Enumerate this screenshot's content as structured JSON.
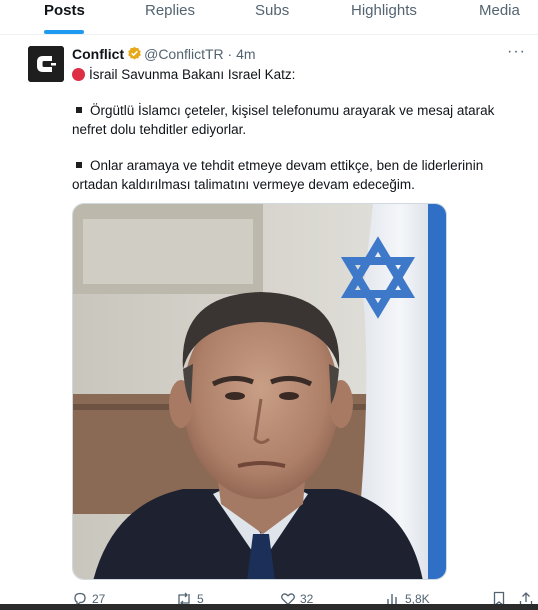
{
  "tabs": [
    {
      "label": "Posts",
      "active": true
    },
    {
      "label": "Replies",
      "active": false
    },
    {
      "label": "Subs",
      "active": false
    },
    {
      "label": "Highlights",
      "active": false
    },
    {
      "label": "Media",
      "active": false
    }
  ],
  "post": {
    "author_name": "Conflict",
    "handle": "@ConflictTR",
    "separator": " · ",
    "time": "4m",
    "more_label": "···",
    "lead": "İsrail Savunma Bakanı Israel Katz:",
    "paragraph1_line1": "Örgütlü İslamcı çeteler, kişisel telefonumu arayarak ve mesaj atarak",
    "paragraph1_line2": "nefret dolu tehditler ediyorlar.",
    "paragraph2_line1": "Onlar aramaya ve tehdit etmeye devam ettikçe, ben de liderlerinin",
    "paragraph2_line2": "ortadan kaldırılması talimatını vermeye devam edeceğim."
  },
  "actions": {
    "replies": "27",
    "reposts": "5",
    "likes": "32",
    "views": "5,8K"
  },
  "colors": {
    "accent": "#1d9bf0",
    "verified": "#e8a818",
    "alert_red": "#dd2e44",
    "muted": "#536471"
  },
  "icons": [
    "c-logo-icon",
    "verified-badge-icon",
    "red-circle-icon",
    "reply-icon",
    "repost-icon",
    "like-icon",
    "views-icon",
    "bookmark-icon",
    "share-icon"
  ]
}
